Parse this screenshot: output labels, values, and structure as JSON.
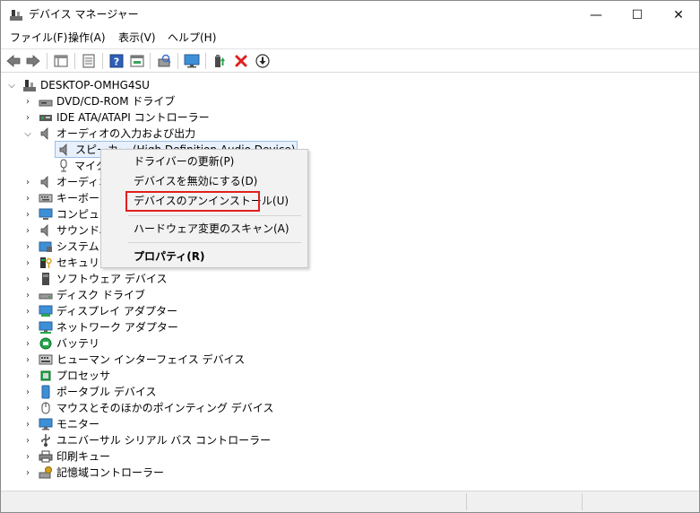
{
  "window": {
    "title": "デバイス マネージャー",
    "controls": {
      "minimize": "—",
      "maximize": "☐",
      "close": "✕"
    }
  },
  "menu": {
    "file": "ファイル(F)",
    "action": "操作(A)",
    "view": "表示(V)",
    "help": "ヘルプ(H)"
  },
  "toolbar": {
    "icons": [
      "back-icon",
      "forward-icon",
      "show-hide-tree-icon",
      "properties-icon",
      "help-icon",
      "view-icon",
      "scan-hardware-icon",
      "monitor-icon",
      "update-driver-icon",
      "uninstall-icon",
      "download-icon"
    ],
    "uninstall_color": "#e0201f"
  },
  "tree": {
    "root": "DESKTOP-OMHG4SU",
    "items": [
      {
        "label": "DVD/CD-ROM ドライブ",
        "icon": "dvd-drive-icon"
      },
      {
        "label": "IDE ATA/ATAPI コントローラー",
        "icon": "ide-controller-icon"
      },
      {
        "label": "オーディオの入力および出力",
        "icon": "speaker-icon"
      },
      {
        "label": "スピーカー (High Definition Audio Device)",
        "icon": "speaker-icon"
      },
      {
        "label": "マイク",
        "icon": "microphone-icon"
      },
      {
        "label": "オーディオ",
        "icon": "speaker-icon"
      },
      {
        "label": "キーボード",
        "icon": "keyboard-icon"
      },
      {
        "label": "コンピュータ",
        "icon": "computer-icon"
      },
      {
        "label": "サウンド、",
        "icon": "speaker-icon"
      },
      {
        "label": "システム デ",
        "icon": "system-device-icon"
      },
      {
        "label": "セキュリティ",
        "icon": "security-device-icon"
      },
      {
        "label": "ソフトウェア デバイス",
        "icon": "software-device-icon"
      },
      {
        "label": "ディスク ドライブ",
        "icon": "disk-drive-icon"
      },
      {
        "label": "ディスプレイ アダプター",
        "icon": "display-adapter-icon"
      },
      {
        "label": "ネットワーク アダプター",
        "icon": "network-adapter-icon"
      },
      {
        "label": "バッテリ",
        "icon": "battery-icon"
      },
      {
        "label": "ヒューマン インターフェイス デバイス",
        "icon": "hid-icon"
      },
      {
        "label": "プロセッサ",
        "icon": "processor-icon"
      },
      {
        "label": "ポータブル デバイス",
        "icon": "portable-device-icon"
      },
      {
        "label": "マウスとそのほかのポインティング デバイス",
        "icon": "mouse-icon"
      },
      {
        "label": "モニター",
        "icon": "monitor-icon"
      },
      {
        "label": "ユニバーサル シリアル バス コントローラー",
        "icon": "usb-icon"
      },
      {
        "label": "印刷キュー",
        "icon": "printer-icon"
      },
      {
        "label": "記憶域コントローラー",
        "icon": "storage-controller-icon"
      }
    ]
  },
  "context_menu": {
    "update_driver": "ドライバーの更新(P)",
    "disable_device": "デバイスを無効にする(D)",
    "uninstall_device": "デバイスのアンインストール(U)",
    "scan_hardware": "ハードウェア変更のスキャン(A)",
    "properties": "プロパティ(R)",
    "highlight_color": "#e0201f"
  }
}
